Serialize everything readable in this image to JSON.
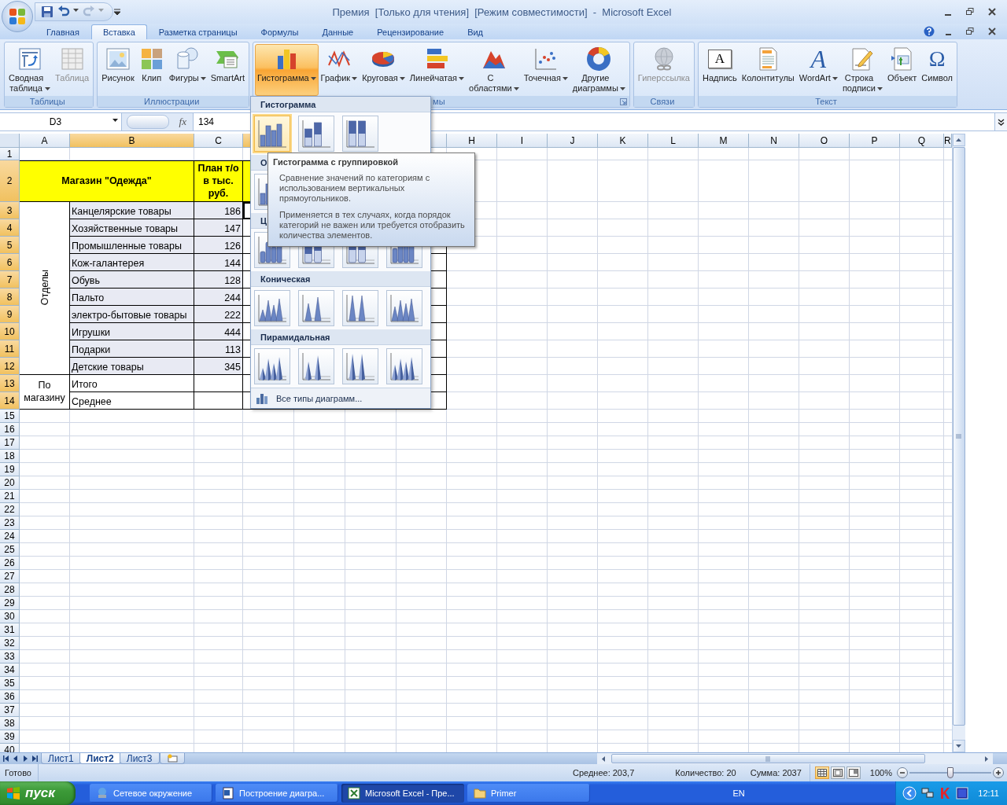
{
  "window": {
    "title": "Премия  [Только для чтения]  [Режим совместимости]  -  Microsoft Excel",
    "quick_access": [
      {
        "kind": "save",
        "disabled": false,
        "dropdown": false
      },
      {
        "kind": "undo",
        "disabled": false,
        "dropdown": true
      },
      {
        "kind": "redo",
        "disabled": true,
        "dropdown": true
      }
    ]
  },
  "tabs": [
    {
      "label": "Главная",
      "selected": false
    },
    {
      "label": "Вставка",
      "selected": true
    },
    {
      "label": "Разметка страницы",
      "selected": false
    },
    {
      "label": "Формулы",
      "selected": false
    },
    {
      "label": "Данные",
      "selected": false
    },
    {
      "label": "Рецензирование",
      "selected": false
    },
    {
      "label": "Вид",
      "selected": false
    }
  ],
  "ribbon": {
    "groups": [
      {
        "label": "Таблицы",
        "launcher": false,
        "buttons": [
          {
            "label": "Сводная таблица",
            "dropdown": true,
            "disabled": false,
            "pressed": false
          },
          {
            "label": "Таблица",
            "dropdown": false,
            "disabled": true,
            "pressed": false
          }
        ]
      },
      {
        "label": "Иллюстрации",
        "launcher": false,
        "buttons": [
          {
            "label": "Рисунок",
            "dropdown": false,
            "disabled": false,
            "pressed": false
          },
          {
            "label": "Клип",
            "dropdown": false,
            "disabled": false,
            "pressed": false
          },
          {
            "label": "Фигуры",
            "dropdown": true,
            "disabled": false,
            "pressed": false
          },
          {
            "label": "SmartArt",
            "dropdown": false,
            "disabled": false,
            "pressed": false
          }
        ]
      },
      {
        "label": "мы",
        "launcher": true,
        "buttons": [
          {
            "label": "Гистограмма",
            "dropdown": true,
            "disabled": false,
            "pressed": true
          },
          {
            "label": "График",
            "dropdown": true,
            "disabled": false,
            "pressed": false
          },
          {
            "label": "Круговая",
            "dropdown": true,
            "disabled": false,
            "pressed": false
          },
          {
            "label": "Линейчатая",
            "dropdown": true,
            "disabled": false,
            "pressed": false
          },
          {
            "label": "С областями",
            "dropdown": true,
            "disabled": false,
            "pressed": false
          },
          {
            "label": "Точечная",
            "dropdown": true,
            "disabled": false,
            "pressed": false
          },
          {
            "label": "Другие диаграммы",
            "dropdown": true,
            "disabled": false,
            "pressed": false
          }
        ]
      },
      {
        "label": "Связи",
        "launcher": false,
        "buttons": [
          {
            "label": "Гиперссылка",
            "dropdown": false,
            "disabled": true,
            "pressed": false
          }
        ]
      },
      {
        "label": "Текст",
        "launcher": false,
        "buttons": [
          {
            "label": "Надпись",
            "glyph": "A",
            "dropdown": false,
            "disabled": false,
            "pressed": false
          },
          {
            "label": "Колонтитулы",
            "dropdown": false,
            "disabled": false,
            "pressed": false
          },
          {
            "label": "WordArt",
            "glyph": "A",
            "dropdown": true,
            "disabled": false,
            "pressed": false
          },
          {
            "label": "Строка подписи",
            "dropdown": true,
            "disabled": false,
            "pressed": false
          },
          {
            "label": "Объект",
            "dropdown": false,
            "disabled": false,
            "pressed": false
          },
          {
            "label": "Символ",
            "glyph": "Ω",
            "dropdown": false,
            "disabled": false,
            "pressed": false
          }
        ]
      }
    ]
  },
  "formula_bar": {
    "name_box": "D3",
    "function_button": "fx",
    "value": "134"
  },
  "sheet": {
    "columns": [
      {
        "label": "A",
        "highlighted": false
      },
      {
        "label": "B",
        "highlighted": true
      },
      {
        "label": "C",
        "highlighted": false
      },
      {
        "highlighted": true
      },
      {},
      {},
      {
        "highlighted": false
      },
      {
        "label": "H",
        "highlighted": false
      },
      {
        "label": "I",
        "highlighted": false
      },
      {
        "label": "J",
        "highlighted": false
      },
      {
        "label": "K",
        "highlighted": false
      },
      {
        "label": "L",
        "highlighted": false
      },
      {
        "label": "M",
        "highlighted": false
      },
      {
        "label": "N",
        "highlighted": false
      },
      {
        "label": "O",
        "highlighted": false
      },
      {
        "label": "P",
        "highlighted": false
      },
      {
        "label": "Q",
        "highlighted": false
      },
      {
        "label": "R",
        "highlighted": false
      }
    ],
    "rows": [
      {
        "label": "1",
        "highlighted": false
      },
      {
        "label": "2",
        "highlighted": true
      },
      {
        "label": "3",
        "highlighted": true
      },
      {
        "label": "4",
        "highlighted": true
      },
      {
        "label": "5",
        "highlighted": true
      },
      {
        "label": "6",
        "highlighted": true
      },
      {
        "label": "7",
        "highlighted": true
      },
      {
        "label": "8",
        "highlighted": true
      },
      {
        "label": "9",
        "highlighted": true
      },
      {
        "label": "10",
        "highlighted": true
      },
      {
        "label": "11",
        "highlighted": true
      },
      {
        "label": "12",
        "highlighted": true
      },
      {
        "label": "13",
        "highlighted": true
      },
      {
        "label": "14",
        "highlighted": true
      },
      {
        "label": "15",
        "highlighted": false
      },
      {
        "label": "16",
        "highlighted": false
      },
      {
        "label": "17",
        "highlighted": false
      },
      {
        "label": "18",
        "highlighted": false
      },
      {
        "label": "19",
        "highlighted": false
      },
      {
        "label": "20",
        "highlighted": false
      },
      {
        "label": "21",
        "highlighted": false
      },
      {
        "label": "22",
        "highlighted": false
      },
      {
        "label": "23",
        "highlighted": false
      },
      {
        "label": "24",
        "highlighted": false
      },
      {
        "label": "25",
        "highlighted": false
      },
      {
        "label": "26",
        "highlighted": false
      },
      {
        "label": "27",
        "highlighted": false
      },
      {
        "label": "28",
        "highlighted": false
      },
      {
        "label": "29",
        "highlighted": false
      },
      {
        "label": "30",
        "highlighted": false
      },
      {
        "label": "31",
        "highlighted": false
      },
      {
        "label": "32",
        "highlighted": false
      },
      {
        "label": "33",
        "highlighted": false
      },
      {
        "label": "34",
        "highlighted": false
      },
      {
        "label": "35",
        "highlighted": false
      },
      {
        "label": "36",
        "highlighted": false
      },
      {
        "label": "37",
        "highlighted": false
      },
      {
        "label": "38",
        "highlighted": false
      },
      {
        "label": "39",
        "highlighted": false
      },
      {
        "label": "40",
        "highlighted": false
      }
    ],
    "title": "Магазин \"Одежда\"",
    "plan_header": "План т/о в тыс. руб.",
    "group_label": "Отделы",
    "items": [
      {
        "name": "Канцелярские товары",
        "value": "186",
        "active": true
      },
      {
        "name": "Хозяйственные товары",
        "value": "147",
        "active": false
      },
      {
        "name": "Промышленные товары",
        "value": "126",
        "active": false
      },
      {
        "name": "Кож-галантерея",
        "value": "144",
        "active": false
      },
      {
        "name": "Обувь",
        "value": "128",
        "active": false
      },
      {
        "name": "Пальто",
        "value": "244",
        "active": false
      },
      {
        "name": "электро-бытовые товары",
        "value": "222",
        "active": false
      },
      {
        "name": "Игрушки",
        "value": "444",
        "active": false
      },
      {
        "name": "Подарки",
        "value": "113",
        "active": false
      },
      {
        "name": "Детские товары",
        "value": "345",
        "active": false
      }
    ],
    "summary_label": "По магазину",
    "summary": [
      {
        "name": "Итого"
      },
      {
        "name": "Среднее"
      }
    ]
  },
  "chart_menu": {
    "sections": [
      {
        "title": "Гистограмма",
        "kind": "column",
        "items": [
          {
            "selected": true
          },
          {
            "selected": false
          },
          {
            "selected": false
          }
        ]
      },
      {
        "title": "О",
        "kind": "column3d",
        "items": [
          {
            "selected": false
          }
        ]
      },
      {
        "title": "Ц",
        "kind": "cylinder",
        "items": [
          {
            "selected": false
          },
          {
            "selected": false
          },
          {
            "selected": false
          },
          {
            "selected": false
          }
        ]
      },
      {
        "title": "Коническая",
        "kind": "cone",
        "items": [
          {
            "selected": false
          },
          {
            "selected": false
          },
          {
            "selected": false
          },
          {
            "selected": false
          }
        ]
      },
      {
        "title": "Пирамидальная",
        "kind": "pyramid",
        "items": [
          {
            "selected": false
          },
          {
            "selected": false
          },
          {
            "selected": false
          },
          {
            "selected": false
          }
        ]
      }
    ],
    "footer": "Все типы диаграмм..."
  },
  "tooltip": {
    "title": "Гистограмма с группировкой",
    "paragraphs": [
      "Сравнение значений по категориям с использованием вертикальных прямоугольников.",
      "Применяется в тех случаях, когда порядок категорий не важен или требуется отобразить количества элементов."
    ]
  },
  "sheet_tabs": [
    {
      "label": "Лист1",
      "selected": false
    },
    {
      "label": "Лист2",
      "selected": true
    },
    {
      "label": "Лист3",
      "selected": false
    }
  ],
  "status_bar": {
    "state": "Готово",
    "average": "Среднее: 203,7",
    "count": "Количество: 20",
    "sum": "Сумма: 2037",
    "views": [
      {
        "selected": true
      },
      {
        "selected": false
      },
      {
        "selected": false
      }
    ],
    "zoom": "100%",
    "zoom_slider": {
      "level": 0.5
    }
  },
  "taskbar": {
    "start": "пуск",
    "tasks": [
      {
        "label": "Сетевое окружение",
        "selected": false
      },
      {
        "label": "Построение диагра...",
        "selected": false
      },
      {
        "label": "Microsoft Excel - Пре...",
        "selected": true
      },
      {
        "label": "Primer",
        "selected": false
      }
    ],
    "language": "EN",
    "clock": "12:11"
  }
}
